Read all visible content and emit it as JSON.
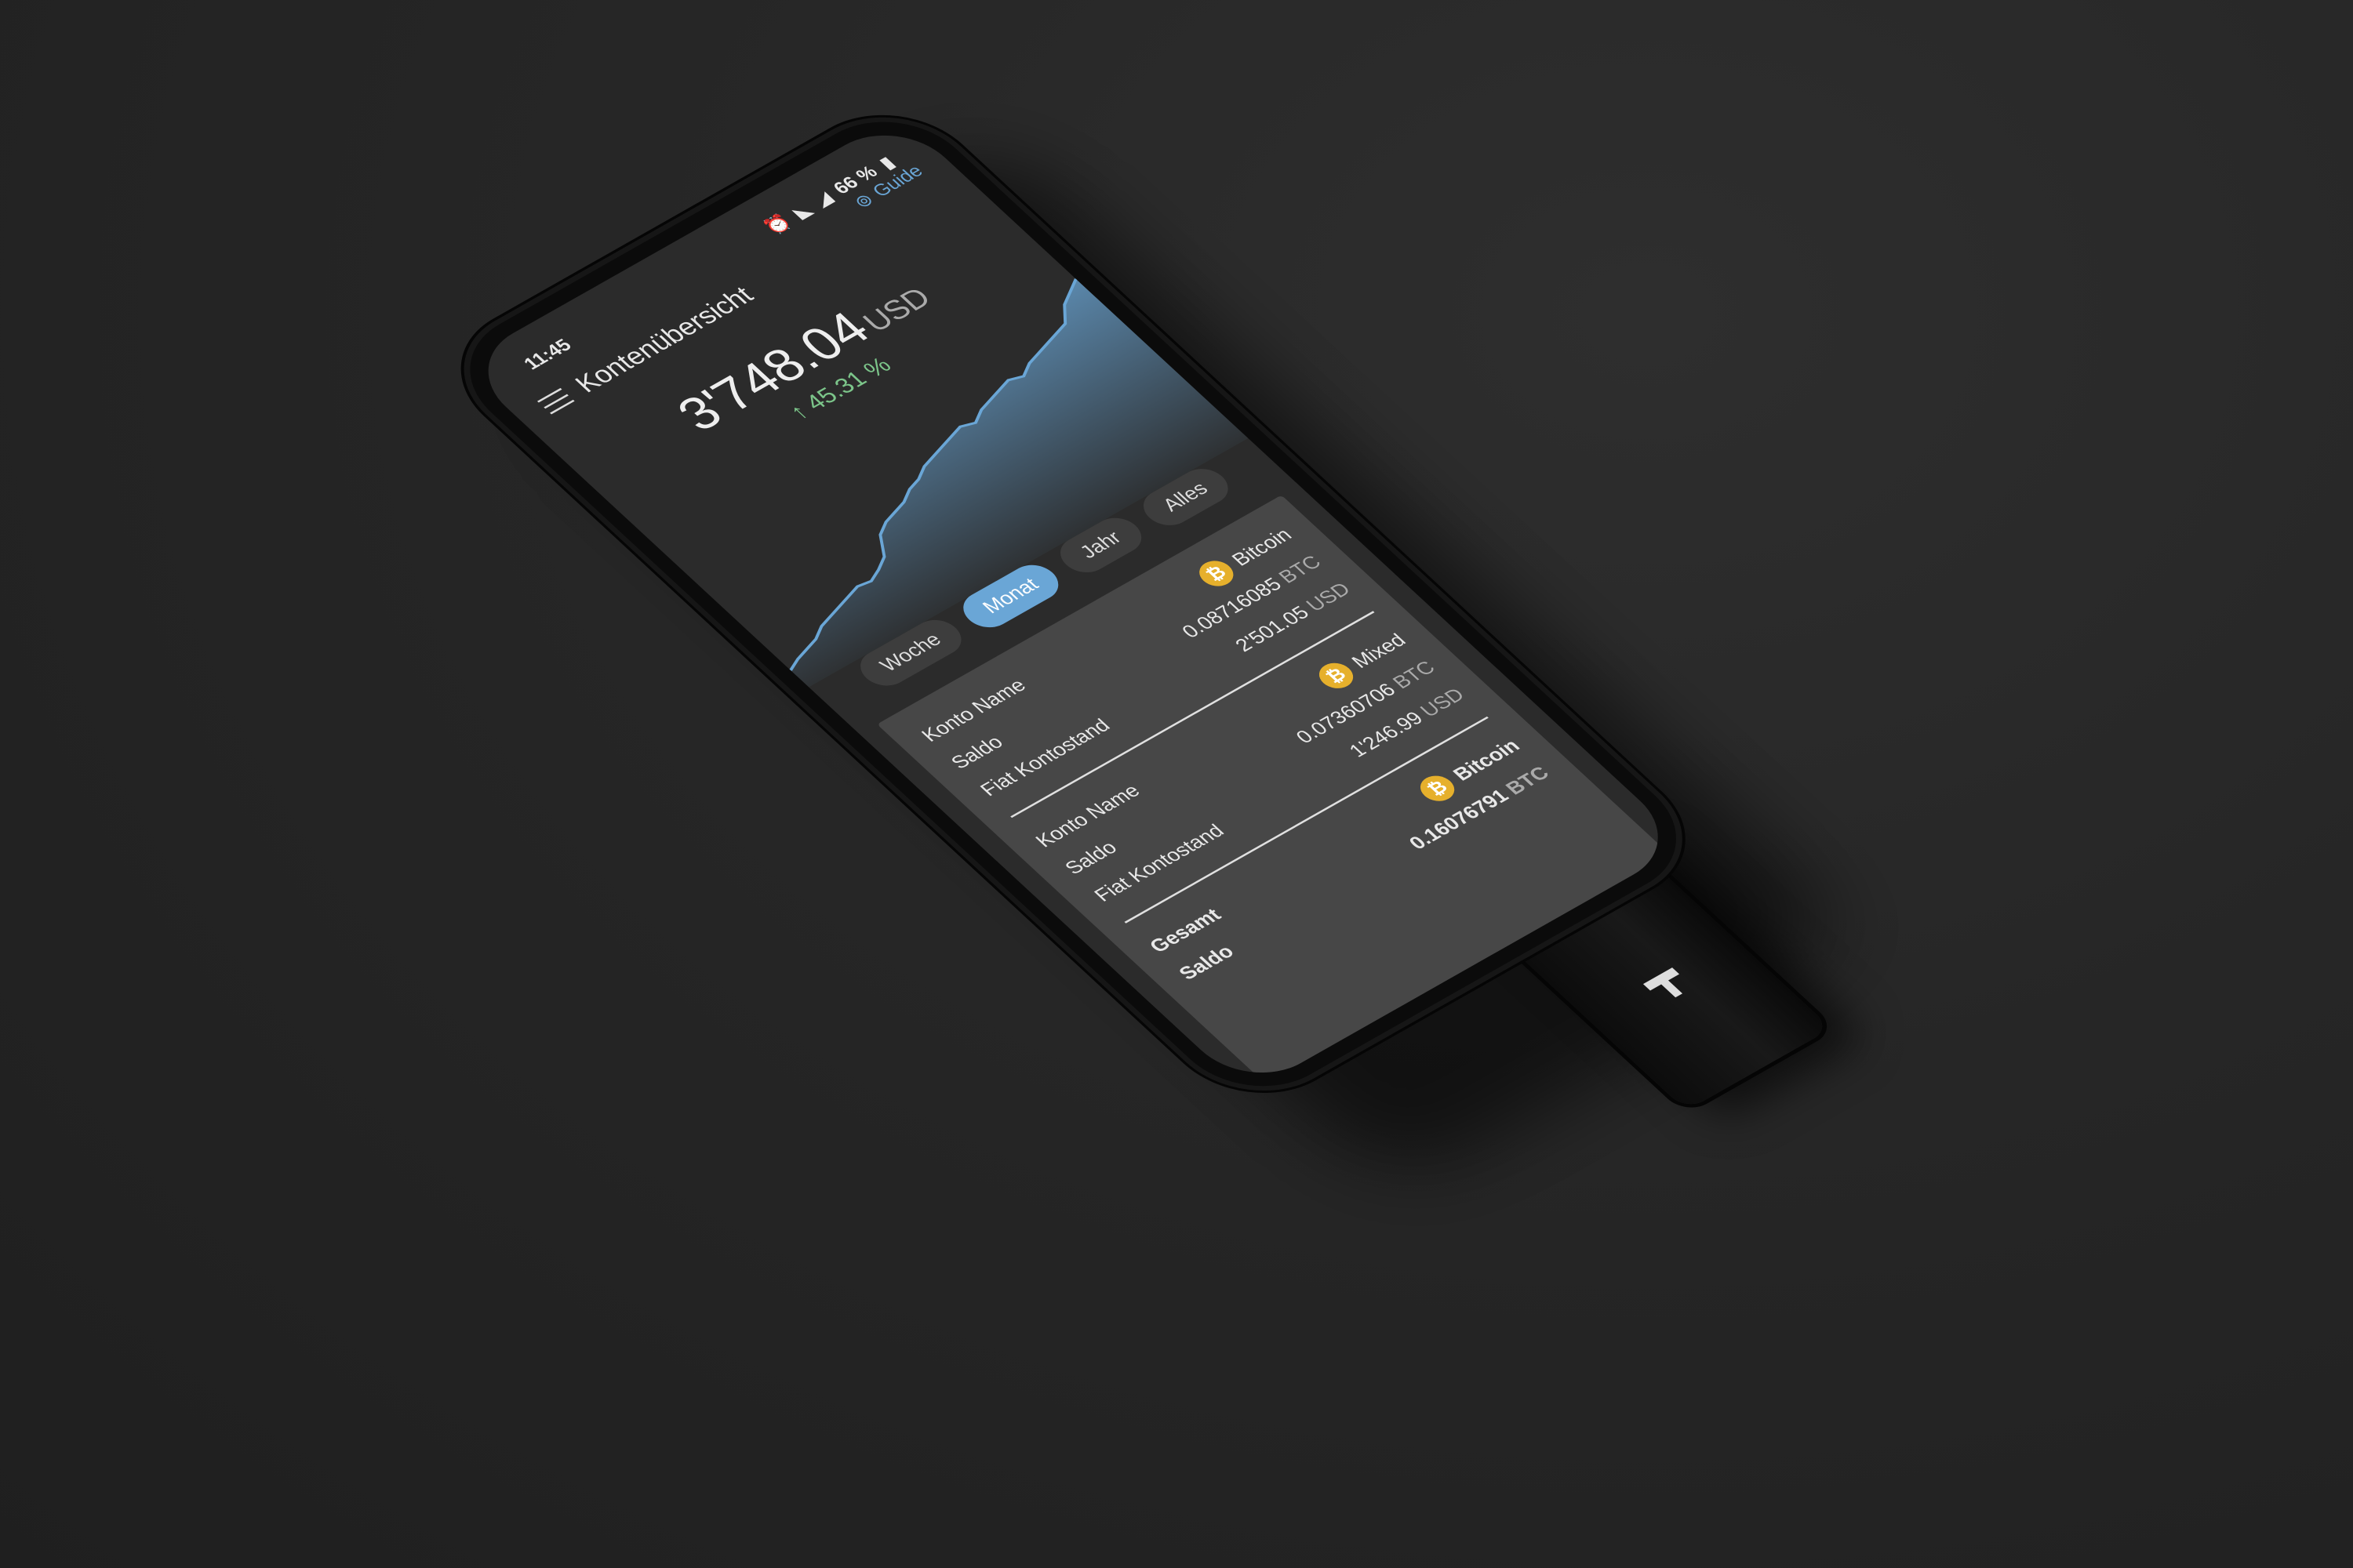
{
  "status_bar": {
    "time": "11:45",
    "battery": "66 %"
  },
  "header": {
    "title": "Kontenübersicht",
    "guide_label": "Guide"
  },
  "balance": {
    "amount": "3'748.04",
    "currency": "USD",
    "change": "45.31 %",
    "change_color": "#7cc58a"
  },
  "chart": {
    "type": "area",
    "line_color": "#6aa6d6",
    "values": [
      5,
      8,
      10,
      12,
      16,
      18,
      20,
      22,
      24,
      23,
      26,
      30,
      40,
      44,
      46,
      48,
      52,
      54,
      58,
      60,
      62,
      64,
      66,
      64,
      68,
      70,
      72,
      74,
      72,
      76,
      78,
      80,
      82,
      84,
      92,
      96,
      100
    ]
  },
  "ranges": [
    {
      "label": "Woche",
      "active": false
    },
    {
      "label": "Monat",
      "active": true
    },
    {
      "label": "Jahr",
      "active": false
    },
    {
      "label": "Alles",
      "active": false
    }
  ],
  "labels": {
    "name": "Konto Name",
    "balance": "Saldo",
    "fiat": "Fiat Kontostand",
    "total": "Gesamt"
  },
  "accounts": [
    {
      "name": "Bitcoin",
      "amount": "0.08716085",
      "unit": "BTC",
      "fiat": "2'501.05",
      "fiat_unit": "USD"
    },
    {
      "name": "Mixed",
      "amount": "0.07360706",
      "unit": "BTC",
      "fiat": "1'246.99",
      "fiat_unit": "USD"
    }
  ],
  "total": {
    "name": "Bitcoin",
    "amount": "0.16076791",
    "unit": "BTC"
  },
  "colors": {
    "accent": "#6aa6d6",
    "bitcoin": "#e6b02c",
    "background": "#262626"
  }
}
